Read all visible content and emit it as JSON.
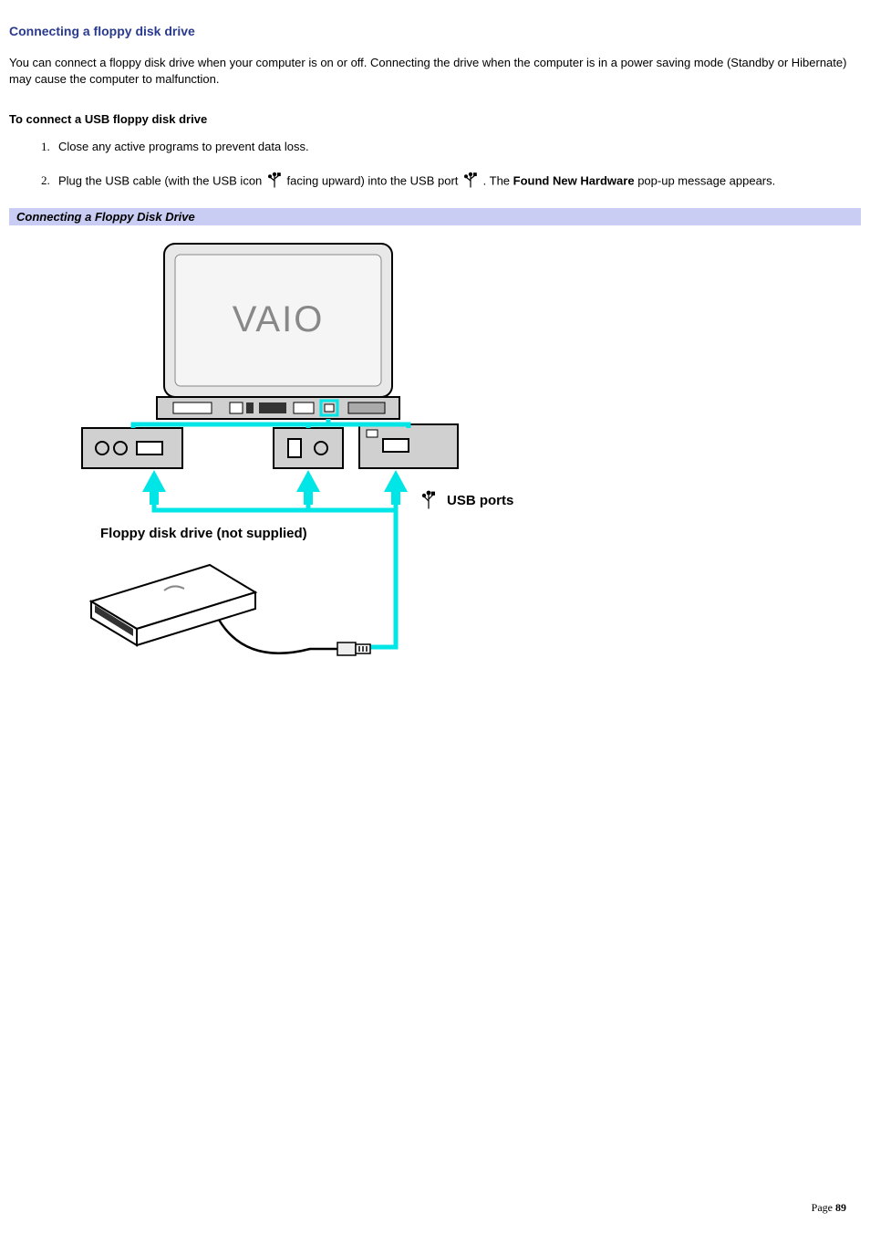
{
  "heading": "Connecting a floppy disk drive",
  "intro": "You can connect a floppy disk drive when your computer is on or off. Connecting the drive when the computer is in a power saving mode (Standby or Hibernate) may cause the computer to malfunction.",
  "subheading": "To connect a USB floppy disk drive",
  "steps": {
    "1": "Close any active programs to prevent data loss.",
    "2": {
      "pre": "Plug the USB cable (with the USB icon ",
      "mid1": " facing upward) into the USB port ",
      "mid2": ". The ",
      "bold": "Found New Hardware",
      "post": " pop-up message appears."
    }
  },
  "caption": "Connecting a Floppy Disk Drive",
  "figure": {
    "usb_ports_label": "USB ports",
    "floppy_label": "Floppy disk drive (not supplied)",
    "laptop_logo": "VAIO"
  },
  "page": {
    "label": "Page ",
    "number": "89"
  }
}
